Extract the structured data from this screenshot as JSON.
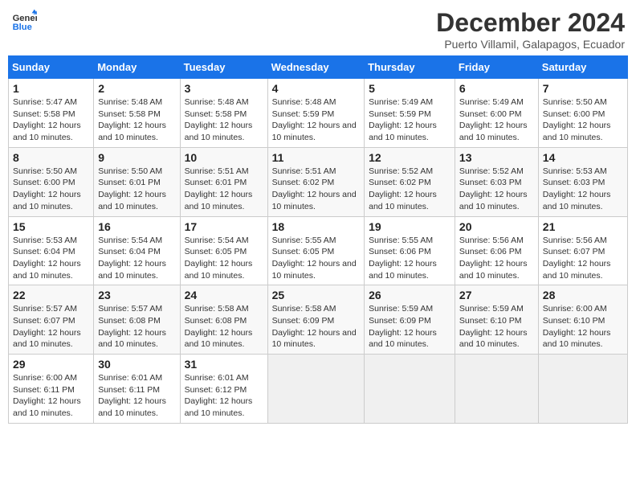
{
  "header": {
    "logo_line1": "General",
    "logo_line2": "Blue",
    "title": "December 2024",
    "subtitle": "Puerto Villamil, Galapagos, Ecuador"
  },
  "days_of_week": [
    "Sunday",
    "Monday",
    "Tuesday",
    "Wednesday",
    "Thursday",
    "Friday",
    "Saturday"
  ],
  "weeks": [
    [
      {
        "date": "1",
        "sunrise": "5:47 AM",
        "sunset": "5:58 PM",
        "daylight": "12 hours and 10 minutes."
      },
      {
        "date": "2",
        "sunrise": "5:48 AM",
        "sunset": "5:58 PM",
        "daylight": "12 hours and 10 minutes."
      },
      {
        "date": "3",
        "sunrise": "5:48 AM",
        "sunset": "5:58 PM",
        "daylight": "12 hours and 10 minutes."
      },
      {
        "date": "4",
        "sunrise": "5:48 AM",
        "sunset": "5:59 PM",
        "daylight": "12 hours and 10 minutes."
      },
      {
        "date": "5",
        "sunrise": "5:49 AM",
        "sunset": "5:59 PM",
        "daylight": "12 hours and 10 minutes."
      },
      {
        "date": "6",
        "sunrise": "5:49 AM",
        "sunset": "6:00 PM",
        "daylight": "12 hours and 10 minutes."
      },
      {
        "date": "7",
        "sunrise": "5:50 AM",
        "sunset": "6:00 PM",
        "daylight": "12 hours and 10 minutes."
      }
    ],
    [
      {
        "date": "8",
        "sunrise": "5:50 AM",
        "sunset": "6:00 PM",
        "daylight": "12 hours and 10 minutes."
      },
      {
        "date": "9",
        "sunrise": "5:50 AM",
        "sunset": "6:01 PM",
        "daylight": "12 hours and 10 minutes."
      },
      {
        "date": "10",
        "sunrise": "5:51 AM",
        "sunset": "6:01 PM",
        "daylight": "12 hours and 10 minutes."
      },
      {
        "date": "11",
        "sunrise": "5:51 AM",
        "sunset": "6:02 PM",
        "daylight": "12 hours and 10 minutes."
      },
      {
        "date": "12",
        "sunrise": "5:52 AM",
        "sunset": "6:02 PM",
        "daylight": "12 hours and 10 minutes."
      },
      {
        "date": "13",
        "sunrise": "5:52 AM",
        "sunset": "6:03 PM",
        "daylight": "12 hours and 10 minutes."
      },
      {
        "date": "14",
        "sunrise": "5:53 AM",
        "sunset": "6:03 PM",
        "daylight": "12 hours and 10 minutes."
      }
    ],
    [
      {
        "date": "15",
        "sunrise": "5:53 AM",
        "sunset": "6:04 PM",
        "daylight": "12 hours and 10 minutes."
      },
      {
        "date": "16",
        "sunrise": "5:54 AM",
        "sunset": "6:04 PM",
        "daylight": "12 hours and 10 minutes."
      },
      {
        "date": "17",
        "sunrise": "5:54 AM",
        "sunset": "6:05 PM",
        "daylight": "12 hours and 10 minutes."
      },
      {
        "date": "18",
        "sunrise": "5:55 AM",
        "sunset": "6:05 PM",
        "daylight": "12 hours and 10 minutes."
      },
      {
        "date": "19",
        "sunrise": "5:55 AM",
        "sunset": "6:06 PM",
        "daylight": "12 hours and 10 minutes."
      },
      {
        "date": "20",
        "sunrise": "5:56 AM",
        "sunset": "6:06 PM",
        "daylight": "12 hours and 10 minutes."
      },
      {
        "date": "21",
        "sunrise": "5:56 AM",
        "sunset": "6:07 PM",
        "daylight": "12 hours and 10 minutes."
      }
    ],
    [
      {
        "date": "22",
        "sunrise": "5:57 AM",
        "sunset": "6:07 PM",
        "daylight": "12 hours and 10 minutes."
      },
      {
        "date": "23",
        "sunrise": "5:57 AM",
        "sunset": "6:08 PM",
        "daylight": "12 hours and 10 minutes."
      },
      {
        "date": "24",
        "sunrise": "5:58 AM",
        "sunset": "6:08 PM",
        "daylight": "12 hours and 10 minutes."
      },
      {
        "date": "25",
        "sunrise": "5:58 AM",
        "sunset": "6:09 PM",
        "daylight": "12 hours and 10 minutes."
      },
      {
        "date": "26",
        "sunrise": "5:59 AM",
        "sunset": "6:09 PM",
        "daylight": "12 hours and 10 minutes."
      },
      {
        "date": "27",
        "sunrise": "5:59 AM",
        "sunset": "6:10 PM",
        "daylight": "12 hours and 10 minutes."
      },
      {
        "date": "28",
        "sunrise": "6:00 AM",
        "sunset": "6:10 PM",
        "daylight": "12 hours and 10 minutes."
      }
    ],
    [
      {
        "date": "29",
        "sunrise": "6:00 AM",
        "sunset": "6:11 PM",
        "daylight": "12 hours and 10 minutes."
      },
      {
        "date": "30",
        "sunrise": "6:01 AM",
        "sunset": "6:11 PM",
        "daylight": "12 hours and 10 minutes."
      },
      {
        "date": "31",
        "sunrise": "6:01 AM",
        "sunset": "6:12 PM",
        "daylight": "12 hours and 10 minutes."
      },
      null,
      null,
      null,
      null
    ]
  ],
  "labels": {
    "sunrise": "Sunrise:",
    "sunset": "Sunset:",
    "daylight": "Daylight:"
  }
}
